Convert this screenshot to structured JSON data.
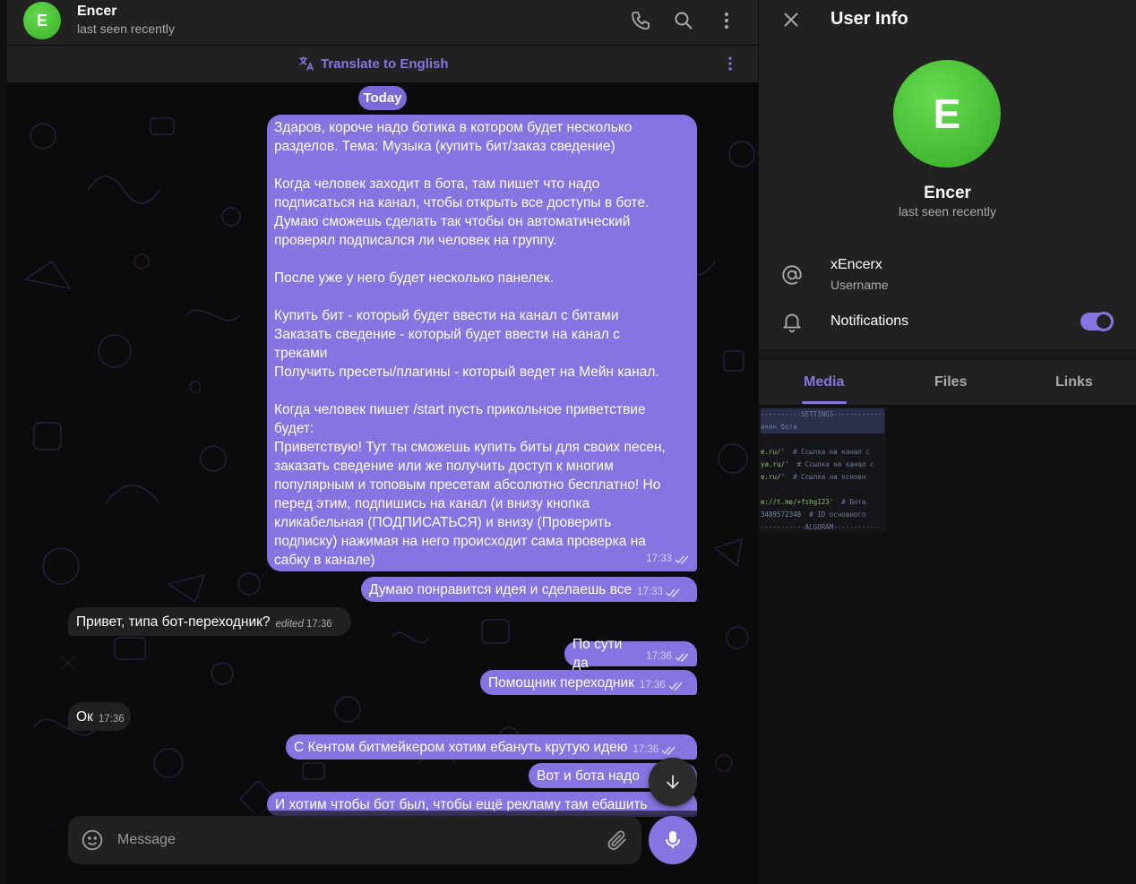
{
  "chat": {
    "peer_name": "Encer",
    "peer_status": "last seen recently",
    "avatar_letter": "E",
    "translate_label": "Translate to English",
    "date_label": "Today",
    "composer_placeholder": "Message",
    "messages": [
      {
        "id": "m1",
        "dir": "out",
        "time": "17:33",
        "text": "Здаров, короче надо ботика в котором будет несколько\nразделов. Тема: Музыка (купить бит/заказ сведение)\n\nКогда человек заходит в бота, там пишет что надо\nподписаться на канал, чтобы открыть все доступы в боте.\nДумаю сможешь сделать так чтобы он автоматический\nпроверял подписался ли человек на группу.\n\nПосле уже у него будет несколько панелек.\n\nКупить бит - который будет ввести на канал с битами\nЗаказать сведение - который будет ввести на канал с\nтреками\nПолучить пресеты/плагины - который ведет на Мейн канал.\n\nКогда человек пишет /start пусть прикольное приветствие\nбудет:\nПриветствую! Тут ты сможешь купить биты для своих песен,\nзаказать сведение или же получить доступ к многим\nпопулярным и топовым пресетам абсолютно бесплатно! Но\nперед этим, подпишись на канал (и внизу кнопка\nкликабельная (ПОДПИСАТЬСЯ) и внизу (Проверить\nподписку) нажимая на него происходит сама проверка на\nсабку в канале)"
      },
      {
        "id": "m2",
        "dir": "out",
        "time": "17:33",
        "text": "Думаю понравится идея и сделаешь все"
      },
      {
        "id": "m3",
        "dir": "in",
        "time": "17:36",
        "edited": "edited",
        "text": "Привет, типа бот-переходник?"
      },
      {
        "id": "m4",
        "dir": "out",
        "time": "17:36",
        "text": "По сути да"
      },
      {
        "id": "m5",
        "dir": "out",
        "time": "17:36",
        "text": "Помощник переходник"
      },
      {
        "id": "m6",
        "dir": "in",
        "time": "17:36",
        "text": "Ок"
      },
      {
        "id": "m7",
        "dir": "out",
        "time": "17:36",
        "text": "С Кентом битмейкером хотим ебануть крутую идею"
      },
      {
        "id": "m8",
        "dir": "out",
        "time": "",
        "text": "Вот и бота надо"
      },
      {
        "id": "m9",
        "dir": "out",
        "time": "",
        "text": "И хотим чтобы бот был, чтобы ещё рекламу там ебашить"
      }
    ]
  },
  "info": {
    "title": "User Info",
    "name": "Encer",
    "status": "last seen recently",
    "avatar_letter": "E",
    "username_value": "xEncerx",
    "username_label": "Username",
    "notifications_label": "Notifications",
    "notifications_on": true,
    "tabs": [
      {
        "label": "Media",
        "active": true
      },
      {
        "label": "Files",
        "active": false
      },
      {
        "label": "Links",
        "active": false
      }
    ]
  },
  "colors": {
    "accent": "#8774e1",
    "bubble_out": "#8774e1",
    "bubble_in": "#212121",
    "avatar": "#4cc23a"
  },
  "icons": [
    "phone-icon",
    "search-icon",
    "more-vertical-icon",
    "translate-icon",
    "close-icon",
    "at-icon",
    "bell-icon",
    "emoji-icon",
    "attach-icon",
    "mic-icon",
    "arrow-down-icon",
    "double-check-icon"
  ]
}
